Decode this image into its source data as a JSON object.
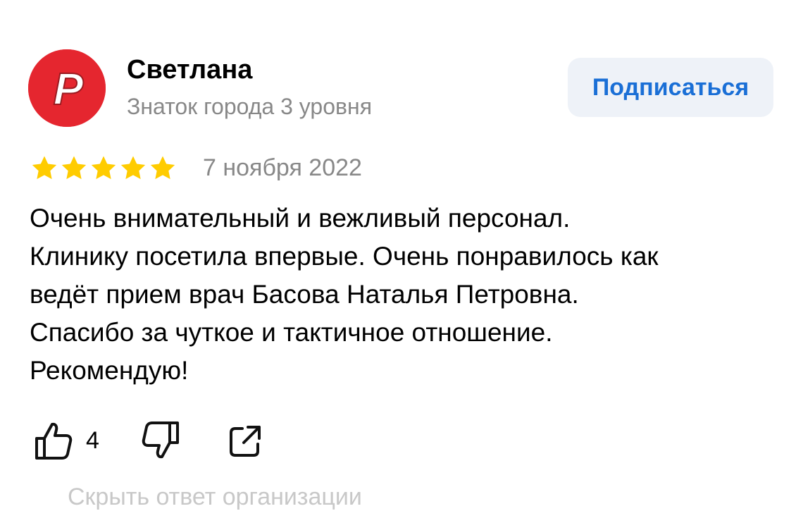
{
  "author": {
    "name": "Светлана",
    "level": "Знаток города 3 уровня",
    "avatar_letter": "P",
    "avatar_color": "#e5262f"
  },
  "subscribe_label": "Подписаться",
  "review": {
    "rating": 5,
    "max_rating": 5,
    "star_color": "#ffcc00",
    "date": "7 ноября 2022",
    "text_lines": [
      "Очень внимательный и вежливый персонал.",
      "Клинику посетила впервые. Очень понравилось как",
      "ведёт прием врач Басова Наталья Петровна.",
      "Спасибо за чуткое и тактичное отношение.",
      "Рекомендую!"
    ]
  },
  "actions": {
    "like_icon": "thumbs-up-icon",
    "like_count": "4",
    "dislike_icon": "thumbs-down-icon",
    "share_icon": "share-icon"
  },
  "hide_response_label": "Скрыть ответ организации"
}
